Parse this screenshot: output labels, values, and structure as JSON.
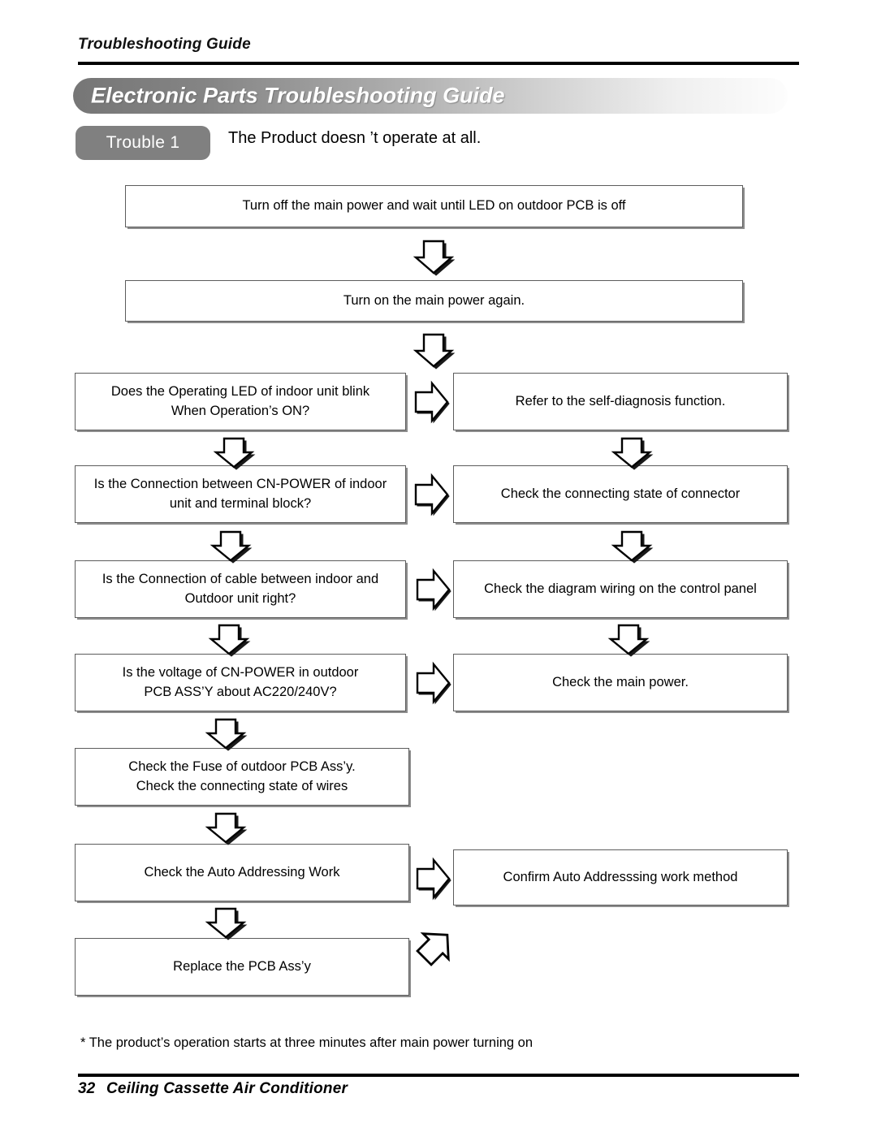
{
  "running_head": "Troubleshooting Guide",
  "banner": {
    "title": "Electronic Parts Troubleshooting Guide",
    "gradient_from": "#767676",
    "gradient_to": "#fdfdfd"
  },
  "trouble": {
    "badge": "Trouble 1",
    "badge_color": "#808080",
    "description": "The Product doesn ’t operate at all."
  },
  "flow": {
    "steps": [
      {
        "id": "step-turn-off-power",
        "text": "Turn off the main power and wait until LED on outdoor PCB is off"
      },
      {
        "id": "step-turn-on-power",
        "text": "Turn on the main power again."
      },
      {
        "id": "step-led-blink-question",
        "line1": "Does the Operating LED of indoor unit blink",
        "line2": "When Operation’s ON?"
      },
      {
        "id": "step-self-diagnosis",
        "text": "Refer to the self-diagnosis function."
      },
      {
        "id": "step-cnpower-question",
        "line1": "Is the Connection between CN-POWER of indoor",
        "line2": "unit and terminal block?"
      },
      {
        "id": "step-check-connector",
        "text": "Check the connecting state of connector"
      },
      {
        "id": "step-cable-question",
        "line1": "Is the Connection of cable between indoor and",
        "line2": "Outdoor unit right?"
      },
      {
        "id": "step-check-diagram-wiring",
        "text": "Check the diagram wiring on the control panel"
      },
      {
        "id": "step-voltage-question",
        "line1": "Is the voltage of CN-POWER in outdoor",
        "line2": "PCB ASS’Y about AC220/240V?"
      },
      {
        "id": "step-check-main-power",
        "text": "Check the main power."
      },
      {
        "id": "step-check-fuse",
        "line1": "Check the Fuse of outdoor PCB Ass’y.",
        "line2": "Check the connecting state of wires"
      },
      {
        "id": "step-check-auto-addressing",
        "text": "Check the Auto Addressing Work"
      },
      {
        "id": "step-confirm-auto-addressing",
        "text": "Confirm Auto Addresssing work method"
      },
      {
        "id": "step-replace-pcb",
        "text": "Replace the PCB Ass’y"
      }
    ]
  },
  "footnote": "* The product’s operation starts at three minutes after main power turning on",
  "footer": {
    "page_number": "32",
    "title": "Ceiling Cassette Air Conditioner"
  }
}
